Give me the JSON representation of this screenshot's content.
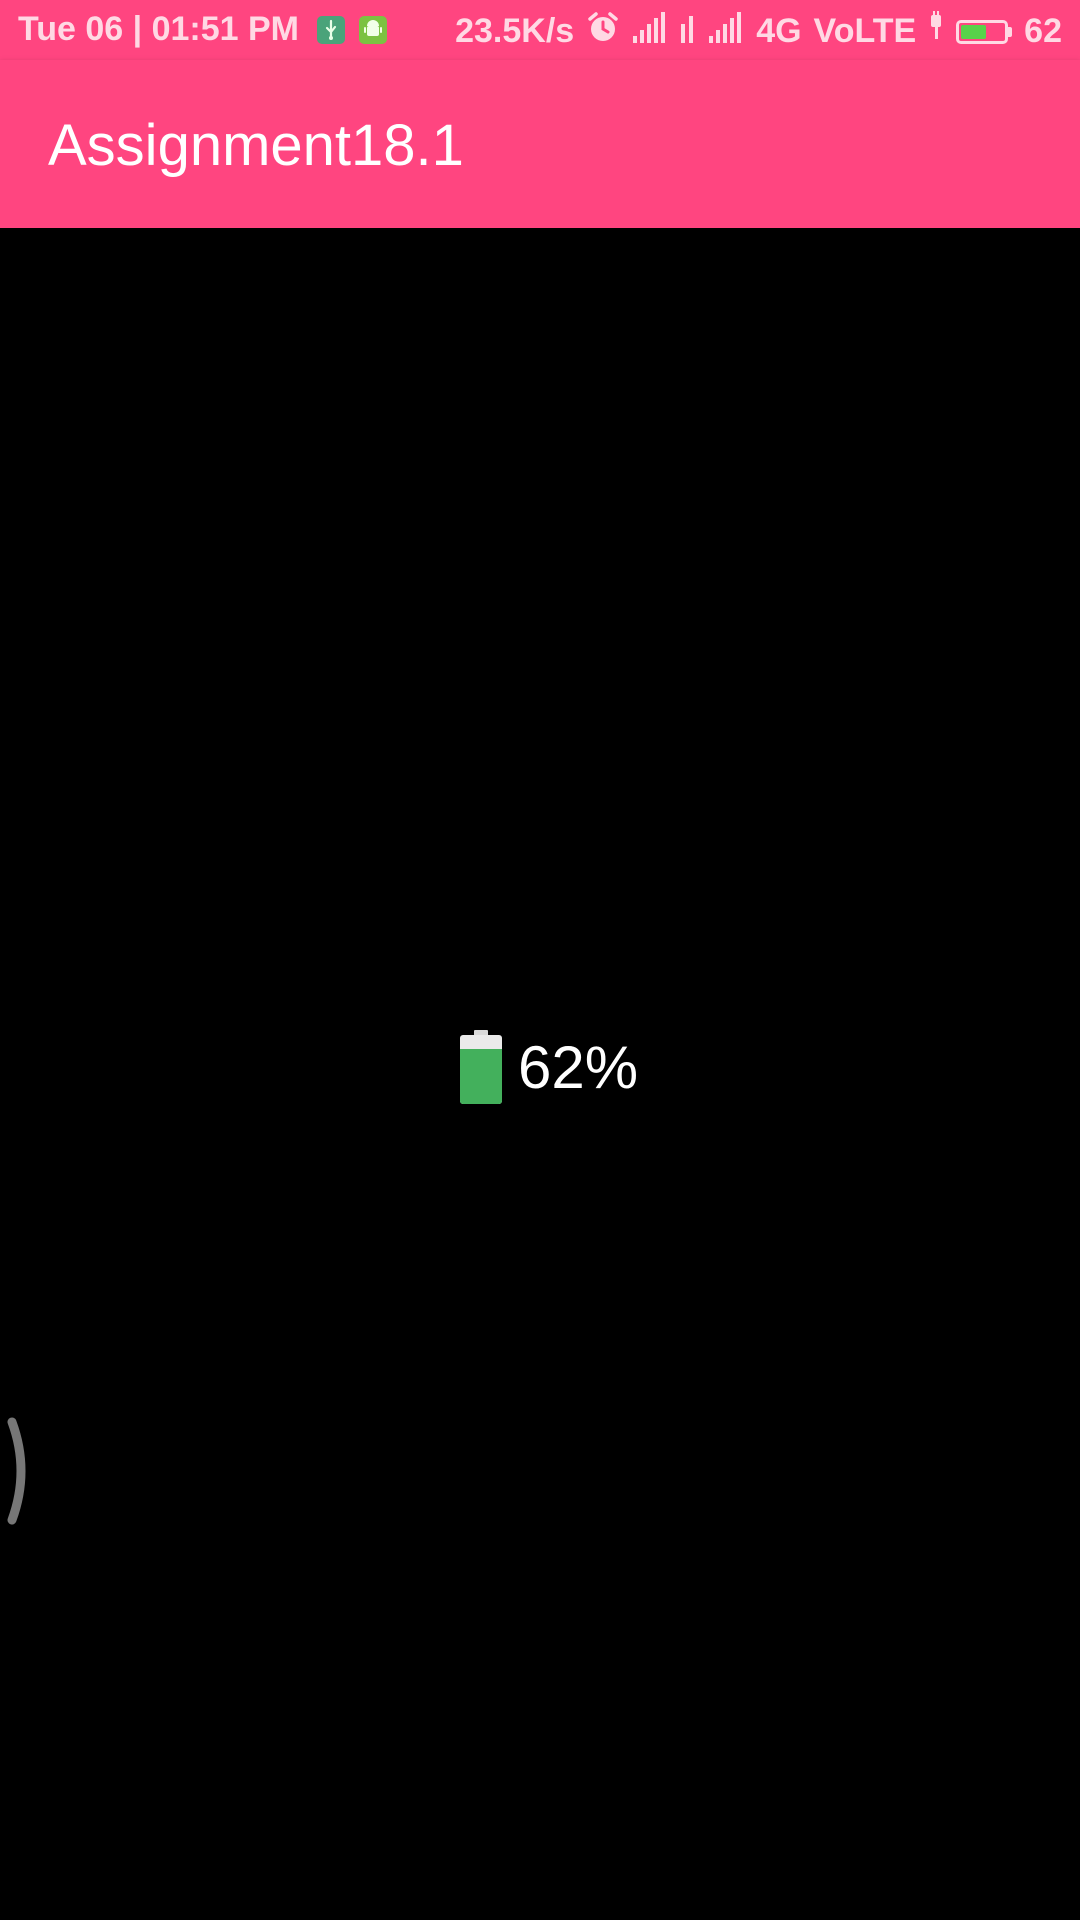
{
  "status_bar": {
    "datetime": "Tue 06 | 01:51 PM",
    "notification_icons": [
      "usb-debugging-icon",
      "android-icon"
    ],
    "network_speed": "23.5K/s",
    "alarm_icon": "alarm-clock-icon",
    "signal_icons": [
      "signal-strength-icon",
      "signal-strength-icon",
      "signal-strength-icon"
    ],
    "network_type": "4G",
    "volte": "VoLTE",
    "charging_icon": "charging-plug-icon",
    "battery_level": 62,
    "battery_text": "62",
    "battery_fill_color": "#58d24a"
  },
  "app_bar": {
    "title": "Assignment18.1",
    "color": "#ff4580"
  },
  "battery_display": {
    "level": 62,
    "percent_text": "62%",
    "icon": "battery-icon",
    "fill_color": "#43b05c"
  },
  "edge_handle": {
    "icon": "edge-swipe-handle-icon"
  }
}
